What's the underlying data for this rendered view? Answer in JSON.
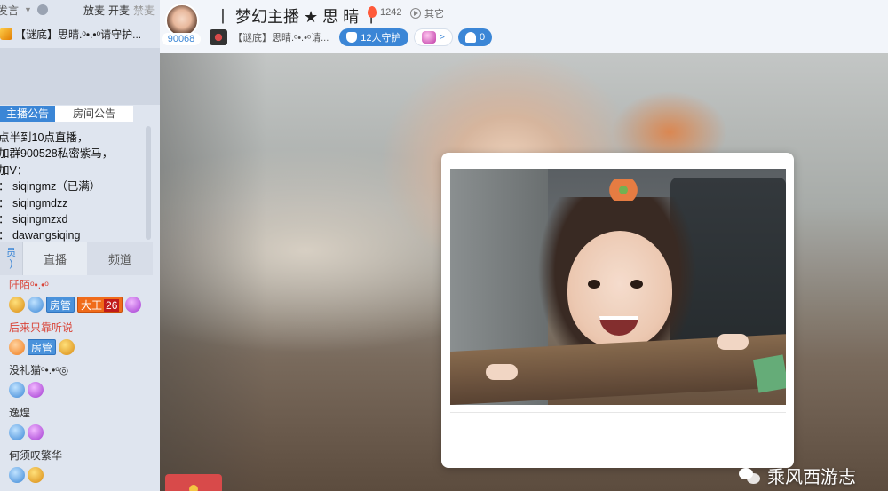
{
  "sidebar": {
    "top_left": "发言",
    "top_right": [
      "放麦",
      "开麦",
      "禁麦"
    ],
    "banner": "【谜底】思晴.ᵒ•.•ᵒ请守护...",
    "notice_tabs": [
      "主播公告",
      "房间公告"
    ],
    "notice_lines": [
      "点半到10点直播，",
      "加群900528私密紫马，",
      "加V：",
      "： siqingmz（已满）",
      "： siqingmdzz",
      "： siqingmzxd",
      "： dawangsiqing"
    ],
    "sub_tabs": [
      "直播",
      "频道"
    ],
    "sub_tab_first": "员\n)",
    "members": [
      {
        "name": "阡陌ᵒ•.•ᵒ",
        "color": "red",
        "tags": [
          "房管"
        ],
        "king": "大王",
        "king_level": "26"
      },
      {
        "name": "后来只靠听说",
        "color": "red",
        "tags": [
          "房管"
        ]
      },
      {
        "name": "没礼猫ᵒ•.•ᵒ◎",
        "color": "dark",
        "tags": []
      },
      {
        "name": "逸煌",
        "color": "dark",
        "tags": []
      },
      {
        "name": "何须叹繁华",
        "color": "dark",
        "tags": []
      }
    ]
  },
  "header": {
    "room_id": "90068",
    "title": "丨 梦幻主播 ★ 思 晴 丨",
    "hot": "1242",
    "other": "其它",
    "guild_name": "【谜底】思晴.ᵒ•.•ᵒ请...",
    "guard_label": "12人守护",
    "vip_label": ">",
    "fans_count": "0"
  },
  "watermark": "乘风西游志",
  "colors": {
    "accent": "#3b86d6",
    "red_name": "#d9463a",
    "king_tag": "#f06b1a"
  }
}
